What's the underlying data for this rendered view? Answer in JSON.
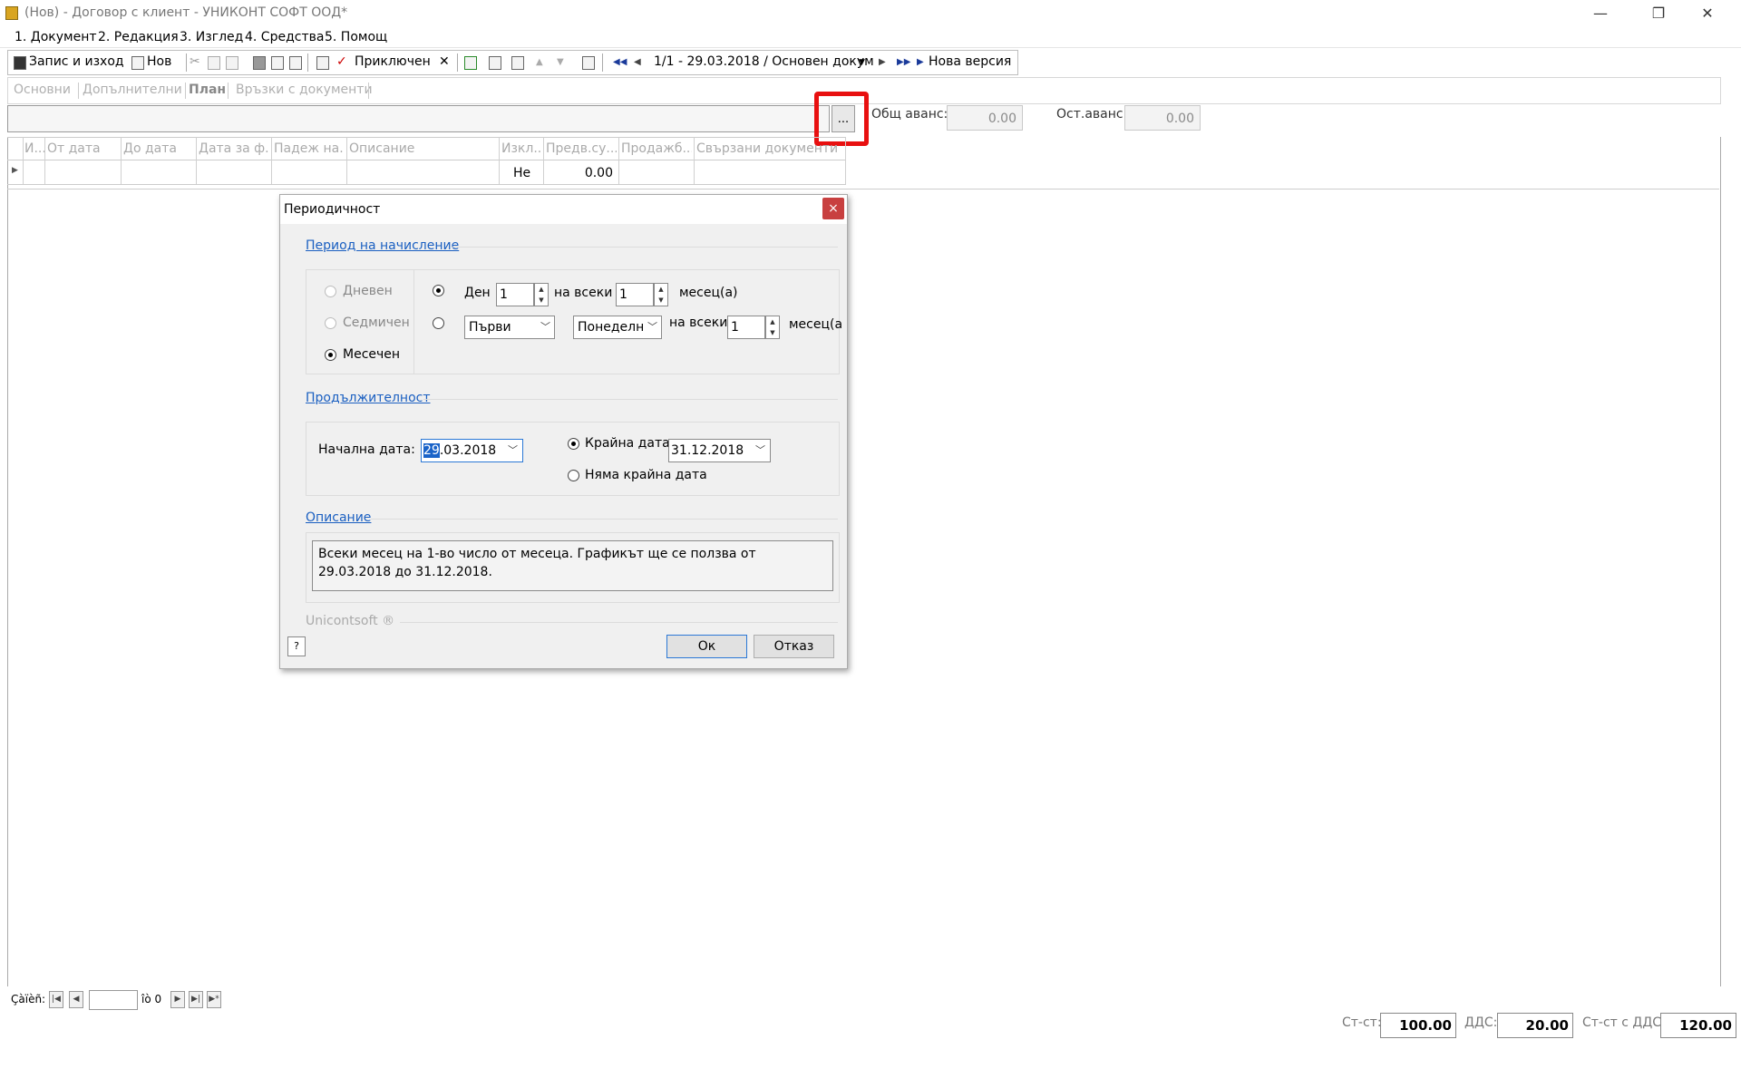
{
  "window": {
    "title": "(Нов) - Договор с клиент - УНИКОНТ СОФТ ООД*",
    "minimize": "—",
    "restore": "❐",
    "close": "✕"
  },
  "menu": [
    "1. Документ",
    "2. Редакция",
    "3. Изглед",
    "4. Средства",
    "5. Помощ"
  ],
  "toolbar": {
    "save_exit": "Запис и изход",
    "new": "Нов",
    "finished": "Приключен",
    "record_nav": "1/1 - 29.03.2018 / Основен докум",
    "new_version": "Нова версия"
  },
  "tabs": [
    "Основни",
    "Допълнителни",
    "План",
    "Връзки с документи"
  ],
  "active_tab": "План",
  "advances": {
    "total_label": "Общ аванс:",
    "total_value": "0.00",
    "remaining_label": "Ост.аванс:",
    "remaining_value": "0.00",
    "ellipsis": "..."
  },
  "grid": {
    "columns": [
      "И...",
      "От дата",
      "До дата",
      "Дата за ф...",
      "Падеж на...",
      "Описание",
      "Изкл...",
      "Предв.су...",
      "Продажб...",
      "Свързани документи"
    ],
    "rows": [
      {
        "excluded": "Не",
        "amount": "0.00"
      }
    ]
  },
  "dialog": {
    "title": "Периодичност",
    "close": "×",
    "accrual_section": "Период на начисление",
    "period_options": [
      {
        "label": "Дневен",
        "checked": false,
        "disabled": true
      },
      {
        "label": "Седмичен",
        "checked": false,
        "disabled": true
      },
      {
        "label": "Месечен",
        "checked": true,
        "disabled": false
      }
    ],
    "day_option": {
      "checked": true,
      "label": "Ден",
      "day_value": "1",
      "every_label": "на всеки",
      "every_value": "1",
      "months_label": "месец(а)"
    },
    "weekday_option": {
      "checked": false,
      "ordinal": "Първи",
      "weekday": "Понеделн",
      "every_label": "на всеки",
      "every_value": "1",
      "months_label": "месец(а"
    },
    "duration_section": "Продължителност",
    "start_label": "Начална дата:",
    "start_value_selected": "29",
    "start_value_rest": ".03.2018",
    "end_label": "Крайна дата:",
    "end_checked": true,
    "end_value": "31.12.2018",
    "no_end_label": "Няма крайна дата",
    "no_end_checked": false,
    "description_section": "Описание",
    "description": "Всеки месец на 1-во число от месеца. Графикът ще се ползва от 29.03.2018 до 31.12.2018.",
    "brand": "Unicontsoft ®",
    "ok": "Ок",
    "cancel": "Отказ"
  },
  "navigator": {
    "label": "Çàïèñ:",
    "of": "îò 0"
  },
  "totals": {
    "net_label": "Ст-ст:",
    "net_value": "100.00",
    "vat_label": "ДДС:",
    "vat_value": "20.00",
    "gross_label": "Ст-ст с ДДС:",
    "gross_value": "120.00"
  },
  "colors": {
    "highlight": "#e81010",
    "link": "#1a5fc1",
    "selection": "#1a63c8"
  }
}
